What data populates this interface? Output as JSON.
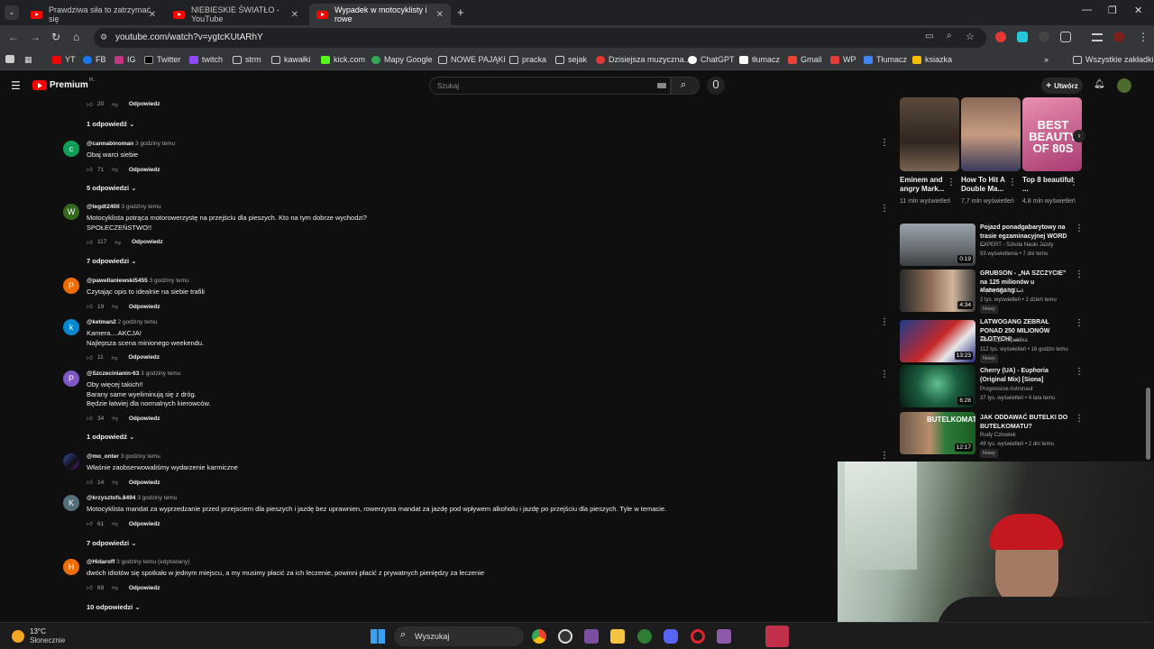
{
  "browser": {
    "tabs": [
      {
        "title": "Prawdziwa siła to zatrzymać się",
        "active": false
      },
      {
        "title": "NIEBIESKIE ŚWIATŁO - YouTube",
        "active": false
      },
      {
        "title": "Wypadek w motocyklisty i rowe",
        "active": true
      }
    ],
    "new_tab": "+",
    "url": "youtube.com/watch?v=ygtcKUtARhY",
    "bookmarks": [
      "YT",
      "FB",
      "IG",
      "Twitter",
      "twitch",
      "strm",
      "kawałki",
      "kick.com",
      "Mapy Google",
      "NOWE PAJĄKI",
      "pracka",
      "sejak",
      "Dzisiejsza muzyczna...",
      "ChatGPT",
      "tłumacz",
      "Gmail",
      "WP",
      "Tłumacz",
      "ksiazka"
    ],
    "all_bookmarks": "Wszystkie zakładki"
  },
  "youtube": {
    "logo": "Premium",
    "logo_region": "PL",
    "search_placeholder": "Szukaj",
    "create_label": "Utwórz"
  },
  "comments": [
    {
      "likes": "20",
      "reply": "Odpowiedz"
    },
    {
      "replies": "1 odpowiedź"
    },
    {
      "avatar": "c",
      "color": "#0f9d58",
      "author": "@cannabinoman",
      "time": "3 godziny temu",
      "text": "Obaj warci siebie",
      "likes": "71",
      "reply": "Odpowiedz",
      "replies": "5 odpowiedzi"
    },
    {
      "avatar": "W",
      "color": "#33691e",
      "author": "@tegdt240ll",
      "time": "3 godziny temu",
      "text": "Motocyklista potrąca motorowerzystę na przejściu dla pieszych. Kto na tym dobrze wychodzi?\nSPOŁECZEŃSTWO!!",
      "likes": "117",
      "reply": "Odpowiedz",
      "replies": "7 odpowiedzi"
    },
    {
      "avatar": "P",
      "color": "#ef6c00",
      "author": "@pawellaniewski5455",
      "time": "3 godziny temu",
      "text": "Czytając opis to idealnie na siebie trafili",
      "likes": "19",
      "reply": "Odpowiedz"
    },
    {
      "avatar": "k",
      "color": "#0288d1",
      "author": "@ketman2",
      "time": "2 godziny temu",
      "text": "Kamera....AKCJA!\nNajlepsza scena minionego weekendu.",
      "likes": "11",
      "reply": "Odpowiedz"
    },
    {
      "avatar": "P",
      "color": "#7e57c2",
      "author": "@Szczecinianin-63",
      "time": "3 godziny temu",
      "text": "Oby więcej takich!!\nBarany same wyeliminują się z dróg.\nBędzie łatwiej dla normalnych kierowców.",
      "likes": "34",
      "reply": "Odpowiedz",
      "replies": "1 odpowiedź"
    },
    {
      "avatar": "",
      "color": "#3949ab",
      "author": "@mo_onter",
      "time": "3 godziny temu",
      "text": "Właśnie zaobserwowaliśmy wydarzenie karmiczne",
      "likes": "14",
      "reply": "Odpowiedz"
    },
    {
      "avatar": "K",
      "color": "#546e7a",
      "author": "@krzysztofs.8494",
      "time": "3 godziny temu",
      "text": "Motocyklista mandat za wyprzedzanie przed przejsciem dla pieszych i jazdę bez uprawnien, rowerzysta mandat za jazdę pod wpływem alkoholu i jazdę po przejściu dla pieszych. Tyle w temacie.",
      "likes": "61",
      "reply": "Odpowiedz",
      "replies": "7 odpowiedzi"
    },
    {
      "avatar": "H",
      "color": "#ef6c00",
      "author": "@Hidaroff",
      "time": "3 godziny temu (edytowany)",
      "text": "dwóch idiotów się spotkało w jednym miejscu, a my musimy płacić za ich leczenie, powinni płacić z prywatnych pieniędzy za leczenie",
      "likes": "69",
      "reply": "Odpowiedz",
      "replies": "10 odpowiedzi"
    }
  ],
  "shorts": [
    {
      "title": "Eminem and angry Mark...",
      "views": "11 mln wyświetleń"
    },
    {
      "title": "How To Hit A Double Ma...",
      "views": "7,7 mln wyświetleń"
    },
    {
      "title": "Top 8 beautiful ...",
      "views": "4,8 mln wyświetleń"
    }
  ],
  "shorts_thumb_text": "BEST BEAUTY OF 80S",
  "videos": [
    {
      "title": "Pojazd ponadgabarytowy na trasie egzaminacyjnej WORD ...",
      "channel": "EXPERT - Szkoła Nauki Jazdy",
      "meta": "93 wyświetlenia • 7 dni temu",
      "duration": "0:19",
      "new": ""
    },
    {
      "title": "GRUBSON - „NA SZCZYCIE” na 125 milionów u #latwogang ...",
      "channel": "więcej SZABLIX-a",
      "meta": "2 tys. wyświetleń • 1 dzień temu",
      "duration": "4:34",
      "new": "Nowy"
    },
    {
      "title": "LATWOGANG ZEBRAŁ PONAD 250 MILIONÓW ZŁOTYCH! ...",
      "channel": "Telewizja Republika",
      "meta": "112 tys. wyświetleń • 16 godzin temu",
      "duration": "13:23",
      "new": "Nowy"
    },
    {
      "title": "Cherry (UA) - Euphoria (Original Mix) [Siona]",
      "channel": "Progressive Astronaut",
      "meta": "37 tys. wyświetleń • 4 lata temu",
      "duration": "6:28",
      "new": ""
    },
    {
      "title": "JAK ODDAWAĆ BUTELKI DO BUTELKOMATU?",
      "channel": "Rudy Człowiek",
      "meta": "49 tys. wyświetleń • 2 dni temu",
      "duration": "12:17",
      "new": "Nowy"
    }
  ],
  "thumb_text": "BUTELKOMAT",
  "taskbar": {
    "temperature": "13°C",
    "weather": "Słonecznie",
    "search": "Wyszukaj"
  },
  "colors": {
    "accent_red": "#ff0000",
    "page_bg": "#0f0f0f"
  }
}
